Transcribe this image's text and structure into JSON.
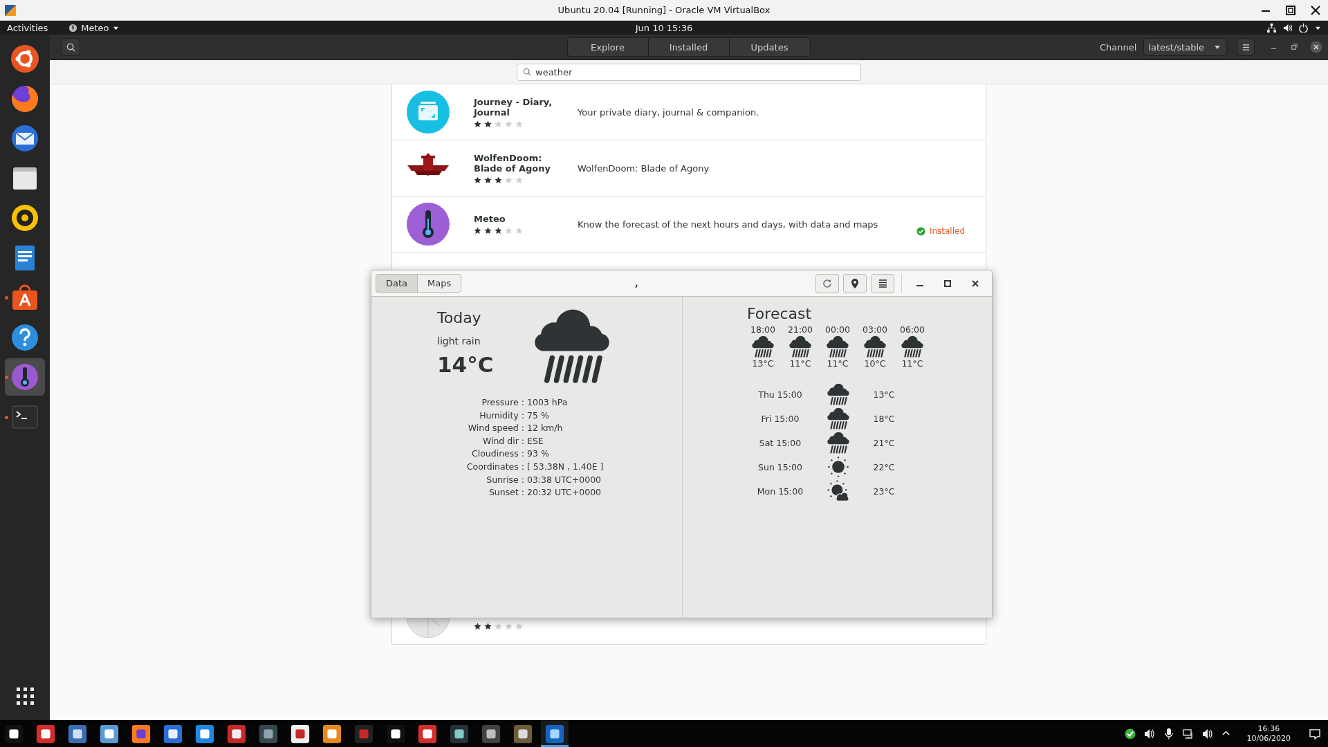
{
  "vm_window": {
    "title": "Ubuntu 20.04 [Running] - Oracle VM VirtualBox"
  },
  "top_bar": {
    "activities": "Activities",
    "app_menu": "Meteo",
    "clock": "Jun 10  15:36"
  },
  "dock": {
    "items": [
      {
        "running": false,
        "selected": false
      },
      {
        "running": false,
        "selected": false
      },
      {
        "running": false,
        "selected": false
      },
      {
        "running": false,
        "selected": false
      },
      {
        "running": false,
        "selected": false
      },
      {
        "running": false,
        "selected": false
      },
      {
        "running": true,
        "selected": false
      },
      {
        "running": false,
        "selected": false
      },
      {
        "running": true,
        "selected": true
      },
      {
        "running": true,
        "selected": false
      }
    ]
  },
  "store": {
    "tabs": [
      {
        "label": "Explore",
        "selected": false
      },
      {
        "label": "Installed",
        "selected": false
      },
      {
        "label": "Updates",
        "selected": false
      }
    ],
    "channel_label": "Channel",
    "channel_value": "latest/stable",
    "search": {
      "value": "weather"
    },
    "apps": [
      {
        "name": "Journey - Diary, Journal",
        "description": "Your private diary, journal & companion.",
        "stars": 2,
        "installed": false
      },
      {
        "name": "WolfenDoom: Blade of Agony",
        "description": "WolfenDoom: Blade of Agony",
        "stars": 3,
        "installed": false
      },
      {
        "name": "Meteo",
        "description": "Know the forecast of the next hours and days, with data and maps",
        "stars": 3,
        "installed": true,
        "status": "Installed"
      },
      {
        "stars": 2,
        "installed": false
      }
    ]
  },
  "meteo": {
    "tabs": [
      {
        "label": "Data",
        "selected": true
      },
      {
        "label": "Maps",
        "selected": false
      }
    ],
    "title": ",",
    "today": {
      "heading": "Today",
      "condition": "light rain",
      "temperature": "14°C",
      "kind": "rain"
    },
    "details": [
      {
        "label": "Pressure :",
        "value": "1003 hPa"
      },
      {
        "label": "Humidity :",
        "value": "75 %"
      },
      {
        "label": "Wind speed :",
        "value": "12 km/h"
      },
      {
        "label": "Wind dir :",
        "value": "ESE"
      },
      {
        "label": "Cloudiness :",
        "value": "93 %"
      },
      {
        "label": "Coordinates :",
        "value": "[ 53.38N , 1.40E ]"
      },
      {
        "label": "Sunrise :",
        "value": "03:38 UTC+0000"
      },
      {
        "label": "Sunset :",
        "value": "20:32 UTC+0000"
      }
    ],
    "forecast": {
      "heading": "Forecast",
      "hourly": [
        {
          "time": "18:00",
          "kind": "rain",
          "temp": "13°C"
        },
        {
          "time": "21:00",
          "kind": "rain",
          "temp": "11°C"
        },
        {
          "time": "00:00",
          "kind": "rain",
          "temp": "11°C"
        },
        {
          "time": "03:00",
          "kind": "rain",
          "temp": "10°C"
        },
        {
          "time": "06:00",
          "kind": "rain",
          "temp": "11°C"
        }
      ],
      "daily": [
        {
          "day": "Thu 15:00",
          "kind": "rain",
          "temp": "13°C"
        },
        {
          "day": "Fri 15:00",
          "kind": "rain",
          "temp": "18°C"
        },
        {
          "day": "Sat 15:00",
          "kind": "rain",
          "temp": "21°C"
        },
        {
          "day": "Sun 15:00",
          "kind": "sun",
          "temp": "22°C"
        },
        {
          "day": "Mon 15:00",
          "kind": "partly_cloudy",
          "temp": "23°C"
        }
      ]
    }
  },
  "taskbar": {
    "items": [
      {
        "selected": false
      },
      {
        "selected": false
      },
      {
        "selected": false
      },
      {
        "selected": false
      },
      {
        "selected": false
      },
      {
        "selected": false
      },
      {
        "selected": false
      },
      {
        "selected": false
      },
      {
        "selected": false
      },
      {
        "selected": false
      },
      {
        "selected": false
      },
      {
        "selected": false
      },
      {
        "selected": false
      },
      {
        "selected": false
      },
      {
        "selected": false
      },
      {
        "selected": false
      },
      {
        "selected": false
      },
      {
        "selected": true
      }
    ],
    "time": "16:36",
    "date": "10/06/2020"
  }
}
